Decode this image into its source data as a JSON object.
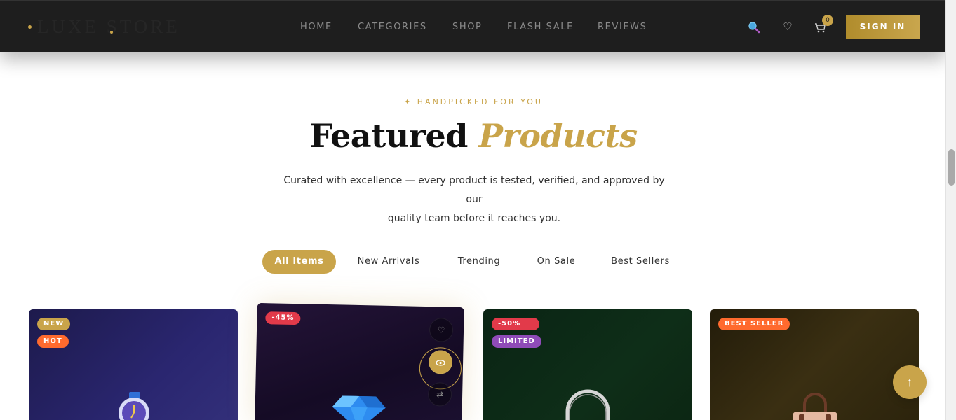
{
  "brand": {
    "name": "LUXE STORE"
  },
  "nav": {
    "items": [
      "HOME",
      "CATEGORIES",
      "SHOP",
      "FLASH SALE",
      "REVIEWS"
    ]
  },
  "header": {
    "cart_count": "0",
    "signin_label": "SIGN IN",
    "icons": [
      "search-icon",
      "heart-icon",
      "cart-icon"
    ]
  },
  "section": {
    "eyebrow": "✦ HANDPICKED FOR YOU",
    "title_main": "Featured",
    "title_accent": "Products",
    "subtitle_line1": "Curated with excellence — every product is tested, verified, and approved by our",
    "subtitle_line2": "quality team before it reaches you."
  },
  "filters": {
    "tabs": [
      "All Items",
      "New Arrivals",
      "Trending",
      "On Sale",
      "Best Sellers"
    ],
    "active": "All Items"
  },
  "products": [
    {
      "tags": [
        "NEW",
        "HOT"
      ]
    },
    {
      "tags": [
        "-45%"
      ]
    },
    {
      "tags": [
        "-50%",
        "LIMITED"
      ]
    },
    {
      "tags": [
        "BEST SELLER"
      ]
    }
  ],
  "colors": {
    "accent": "#c9a44a",
    "header_bg": "#1e1e1e",
    "hot": "#ff6a2e",
    "discount": "#e23a4a",
    "limited": "#8f4bb8"
  }
}
